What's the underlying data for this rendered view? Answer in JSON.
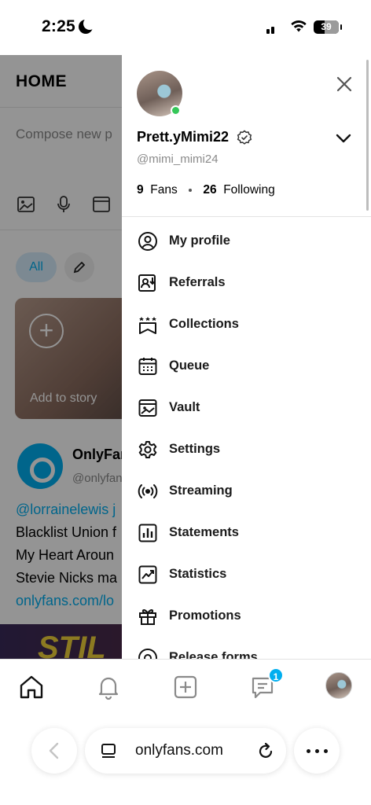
{
  "status_bar": {
    "time": "2:25",
    "battery": "39"
  },
  "background_page": {
    "title": "HOME",
    "compose_placeholder": "Compose new p",
    "filter_all": "All",
    "story_label": "Add to story",
    "post_author": "OnlyFan",
    "post_handle": "@onlyfan",
    "post_lines": [
      "@lorrainelewis j",
      "Blacklist Union f",
      "My Heart Aroun",
      "Stevie Nicks ma",
      "onlyfans.com/lo"
    ]
  },
  "drawer": {
    "display_name": "Prett.yMimi22",
    "handle": "@mimi_mimi24",
    "fans_count": "9",
    "fans_label": "Fans",
    "following_count": "26",
    "following_label": "Following",
    "menu": [
      {
        "label": "My profile",
        "icon": "profile-icon"
      },
      {
        "label": "Referrals",
        "icon": "referrals-icon"
      },
      {
        "label": "Collections",
        "icon": "collections-icon"
      },
      {
        "label": "Queue",
        "icon": "calendar-icon"
      },
      {
        "label": "Vault",
        "icon": "vault-icon"
      },
      {
        "label": "Settings",
        "icon": "gear-icon"
      },
      {
        "label": "Streaming",
        "icon": "streaming-icon"
      },
      {
        "label": "Statements",
        "icon": "statements-icon"
      },
      {
        "label": "Statistics",
        "icon": "statistics-icon"
      },
      {
        "label": "Promotions",
        "icon": "gift-icon"
      },
      {
        "label": "Release forms",
        "icon": "release-forms-icon"
      }
    ]
  },
  "bottom_nav": {
    "messages_badge": "1"
  },
  "browser": {
    "url": "onlyfans.com"
  },
  "colors": {
    "accent": "#00aeef",
    "online": "#35c759"
  }
}
